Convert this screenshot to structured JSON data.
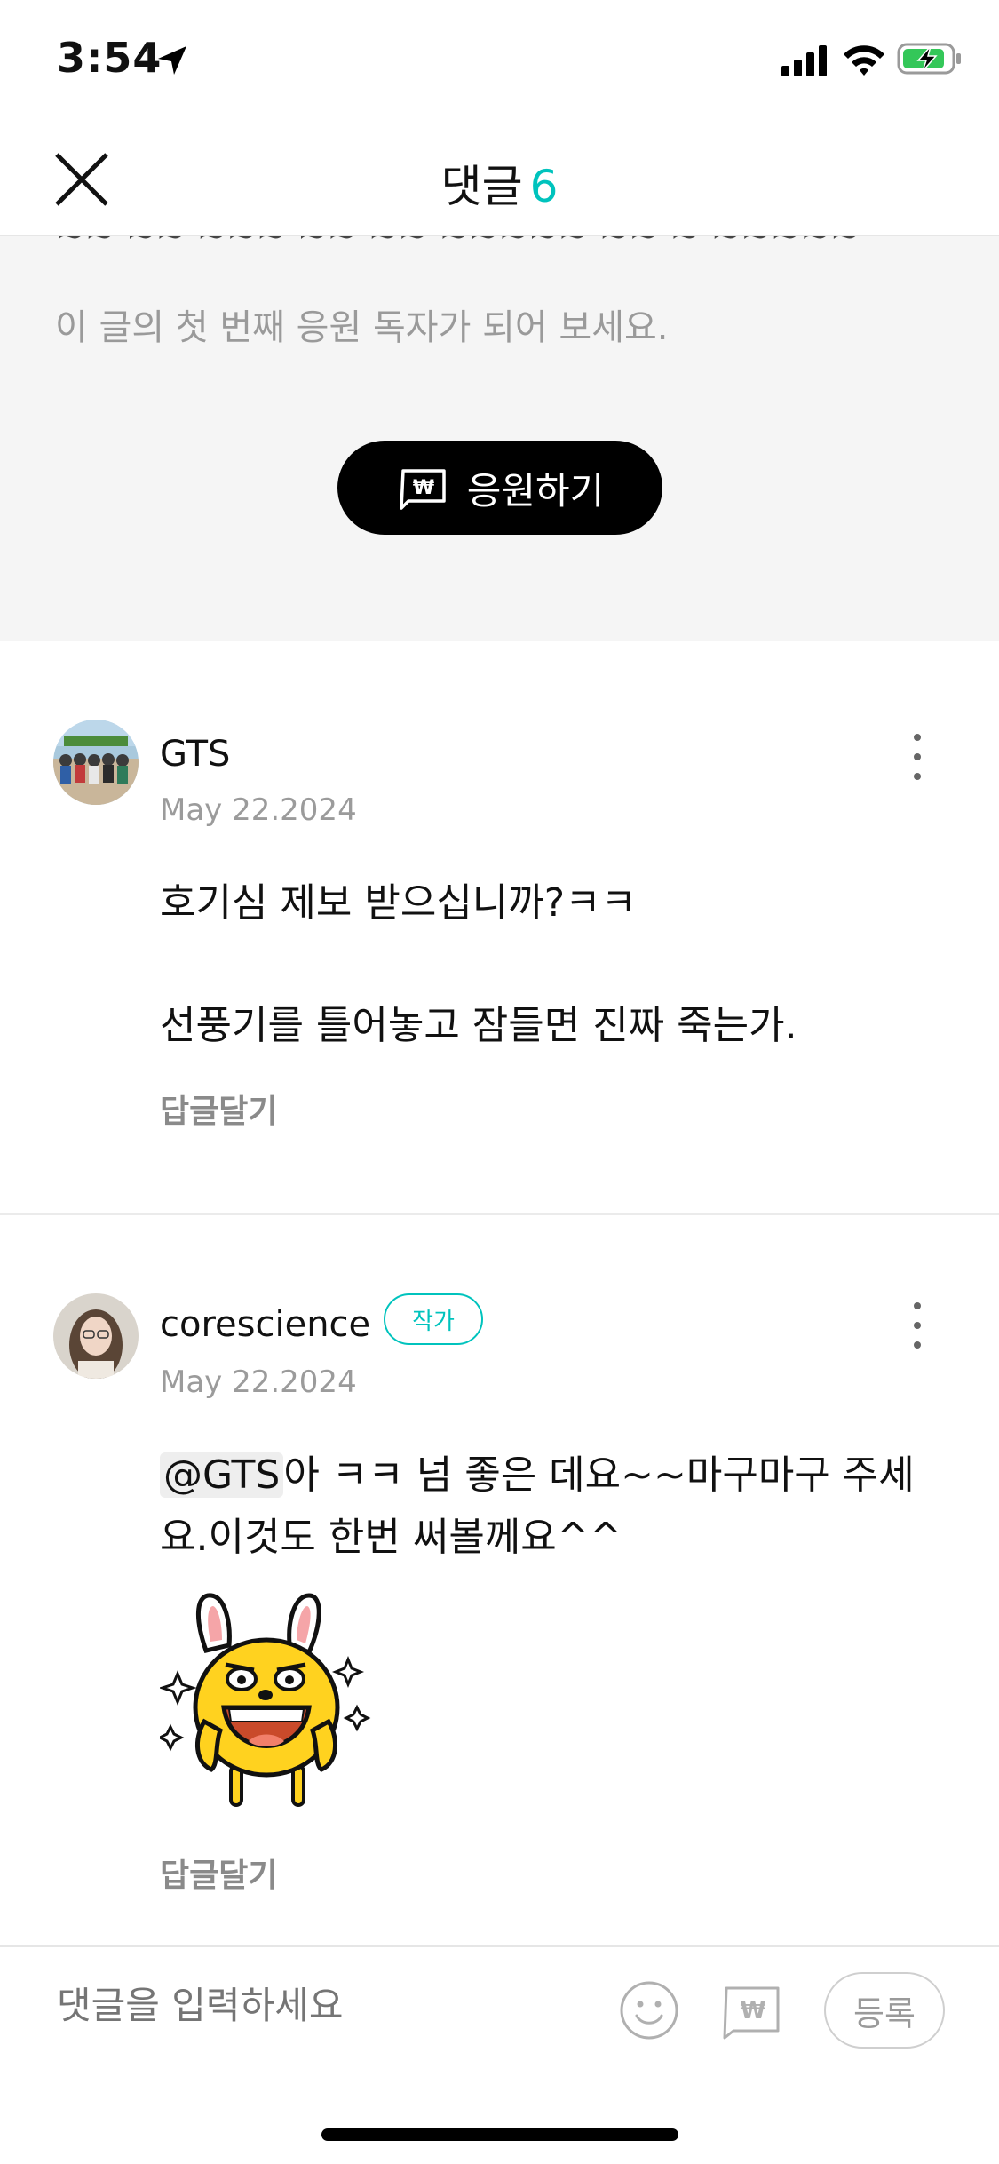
{
  "status_bar": {
    "time": "3:54"
  },
  "header": {
    "title": "댓글",
    "count": "6"
  },
  "support": {
    "cut_text": "~~ ~~ ~~~ ~~ ~~ ~~~~~ ~~ ~ ~~~~~",
    "description": "이 글의 첫 번째 응원 독자가 되어 보세요.",
    "button_label": "응원하기"
  },
  "comments": [
    {
      "username": "GTS",
      "date": "May 22.2024",
      "lines": [
        "호기심 제보 받으십니까?ㅋㅋ",
        "선풍기를 틀어놓고 잠들면 진짜 죽는가."
      ],
      "reply_label": "답글달기"
    },
    {
      "username": "corescience",
      "badge": "작가",
      "date": "May 22.2024",
      "mention": "@GTS",
      "line1_rest": "아 ㅋㅋ 넘 좋은 데요~~마구마구 주세",
      "line2": "요.이것도 한번 써볼께요^^",
      "reply_label": "답글달기"
    }
  ],
  "input_bar": {
    "placeholder": "댓글을 입력하세요",
    "register_label": "등록"
  },
  "colors": {
    "accent": "#00c3bd",
    "button_dark": "#000000",
    "banner_bg": "#f5f5f5"
  },
  "icons": [
    "location-arrow-icon",
    "signal-icon",
    "wifi-icon",
    "battery-charging-icon",
    "close-icon",
    "won-support-icon",
    "more-vertical-icon",
    "emoji-icon"
  ]
}
